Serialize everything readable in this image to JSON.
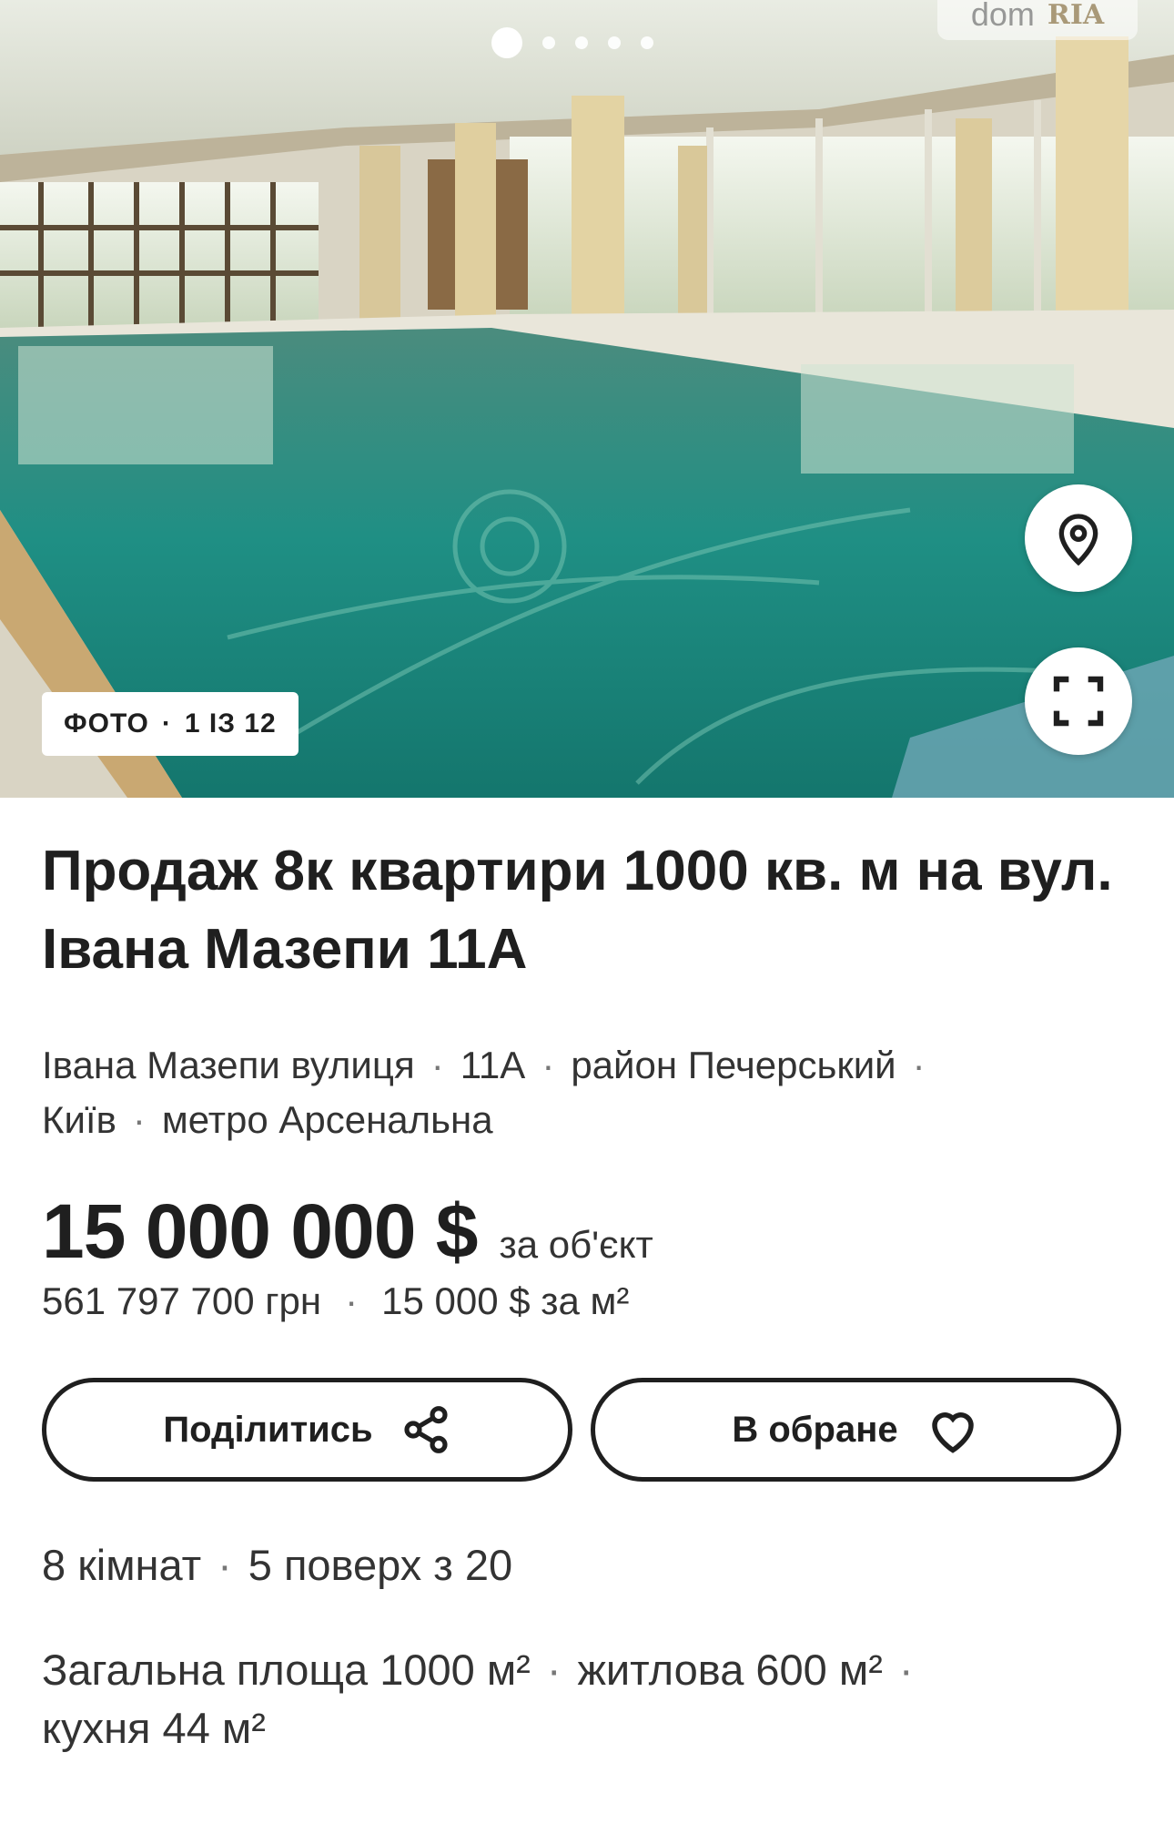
{
  "gallery": {
    "dots_total": 5,
    "dots_active": 1,
    "watermark_left": "dom",
    "watermark_right": "RIA",
    "counter_label": "ФОТО",
    "counter_value": "1 ІЗ 12",
    "location_icon": "location-pin-icon",
    "fullscreen_icon": "fullscreen-icon"
  },
  "listing": {
    "title": "Продаж 8к квартири 1000 кв. м на вул. Івана Мазепи 11А",
    "address_parts": [
      "Івана Мазепи вулиця",
      "11А",
      "район Печерський",
      "Київ",
      "метро Арсенальна"
    ],
    "price": "15 000 000 $",
    "price_unit": "за об'єкт",
    "price_uah": "561 797 700 грн",
    "price_per_m2": "15 000 $ за м²",
    "rooms": "8 кімнат",
    "floor": "5 поверх з 20",
    "total_area": "Загальна площа 1000 м²",
    "living_area": "житлова 600 м²",
    "kitchen_area": "кухня 44 м²"
  },
  "actions": {
    "share_label": "Поділитись",
    "share_icon": "share-icon",
    "favorite_label": "В обране",
    "favorite_icon": "heart-icon"
  },
  "colors": {
    "text": "#1f1f1f",
    "water": "#1f8f84",
    "background": "#ffffff"
  }
}
